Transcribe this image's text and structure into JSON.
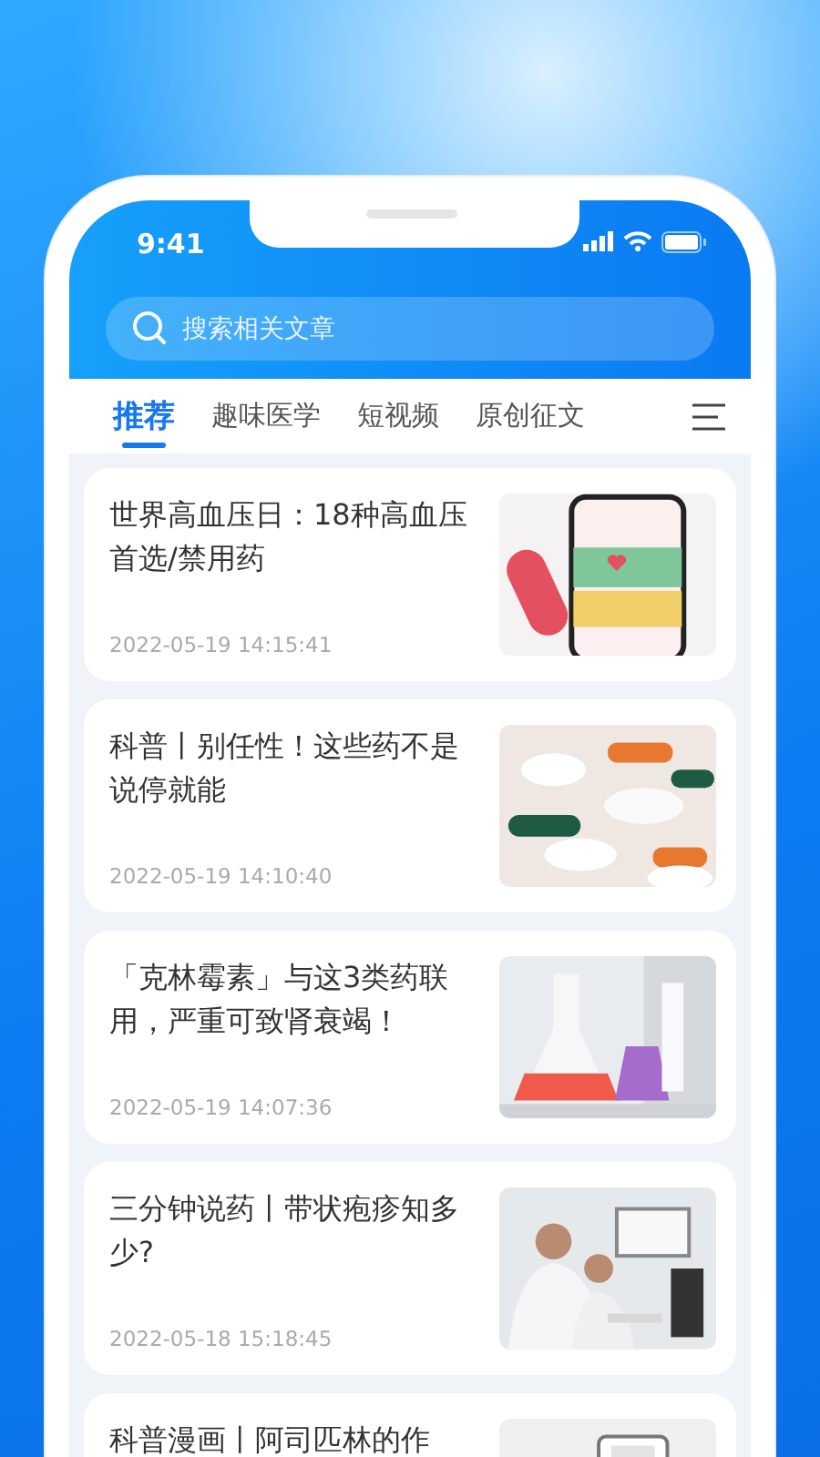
{
  "status_bar": {
    "time": "9:41"
  },
  "search": {
    "placeholder": "搜索相关文章"
  },
  "tabs": [
    {
      "label": "推荐",
      "selected": true
    },
    {
      "label": "趣味医学",
      "selected": false
    },
    {
      "label": "短视频",
      "selected": false
    },
    {
      "label": "原创征文",
      "selected": false
    }
  ],
  "articles": [
    {
      "title": "世界高血压日：18种高血压首选/禁用药",
      "date": "2022-05-19 14:15:41"
    },
    {
      "title": "科普丨别任性！这些药不是说停就能",
      "date": "2022-05-19 14:10:40"
    },
    {
      "title": "「克林霉素」与这3类药联用，严重可致肾衰竭！",
      "date": "2022-05-19 14:07:36"
    },
    {
      "title": "三分钟说药丨带状疱疹知多少?",
      "date": "2022-05-18 15:18:45"
    },
    {
      "title": "科普漫画丨阿司匹林的作"
    }
  ]
}
